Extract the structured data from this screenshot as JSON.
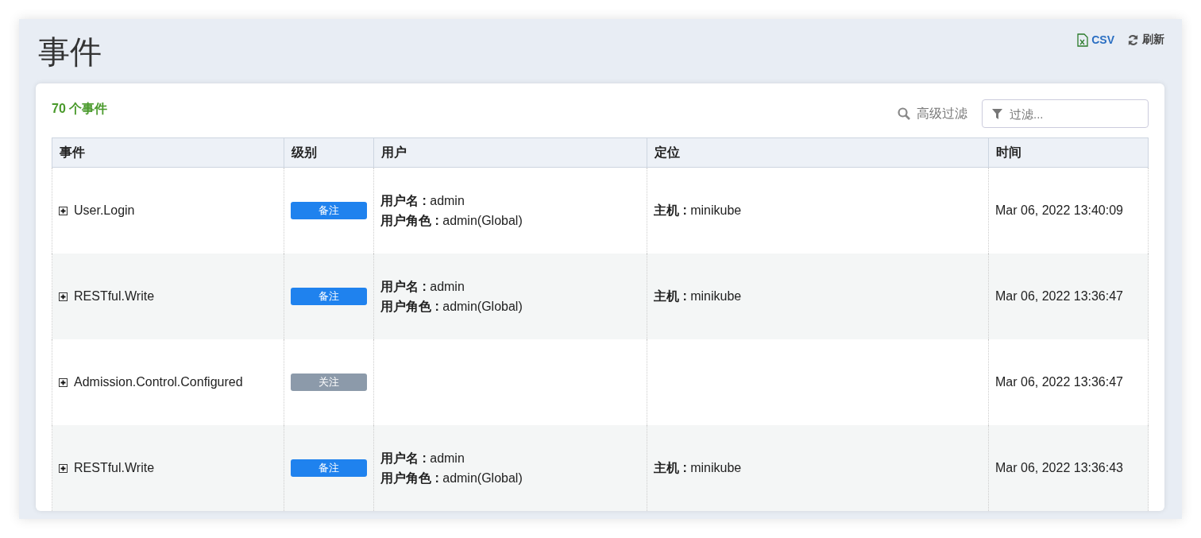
{
  "page": {
    "title": "事件"
  },
  "toolbar": [
    {
      "kind": "csv",
      "label": "CSV"
    },
    {
      "kind": "refresh",
      "label": "刷新"
    }
  ],
  "summary": "70 个事件",
  "advanced_filter": "高级过滤",
  "filter": {
    "placeholder": "过滤..."
  },
  "table": {
    "columns": [
      "事件",
      "级别",
      "用户",
      "定位",
      "时间"
    ],
    "rows": [
      {
        "event": "User.Login",
        "expanded": false,
        "level": {
          "kind": "note",
          "label": "备注"
        },
        "user": [
          "**用户名 :** admin",
          "**用户角色 :** admin(Global)"
        ],
        "location": "**主机 :** minikube",
        "time": "Mar 06, 2022 13:40:09"
      },
      {
        "event": "RESTful.Write",
        "expanded": false,
        "level": {
          "kind": "note",
          "label": "备注"
        },
        "user": [
          "**用户名 :** admin",
          "**用户角色 :** admin(Global)"
        ],
        "location": "**主机 :** minikube",
        "time": "Mar 06, 2022 13:36:47"
      },
      {
        "event": "Admission.Control.Configured",
        "expanded": false,
        "level": {
          "kind": "watch",
          "label": "关注"
        },
        "user": [],
        "time": "Mar 06, 2022 13:36:47"
      },
      {
        "event": "RESTful.Write",
        "expanded": false,
        "level": {
          "kind": "note",
          "label": "备注"
        },
        "user": [
          "**用户名 :** admin",
          "**用户角色 :** admin(Global)"
        ],
        "location": "**主机 :** minikube",
        "time": "Mar 06, 2022 13:36:43"
      }
    ]
  }
}
